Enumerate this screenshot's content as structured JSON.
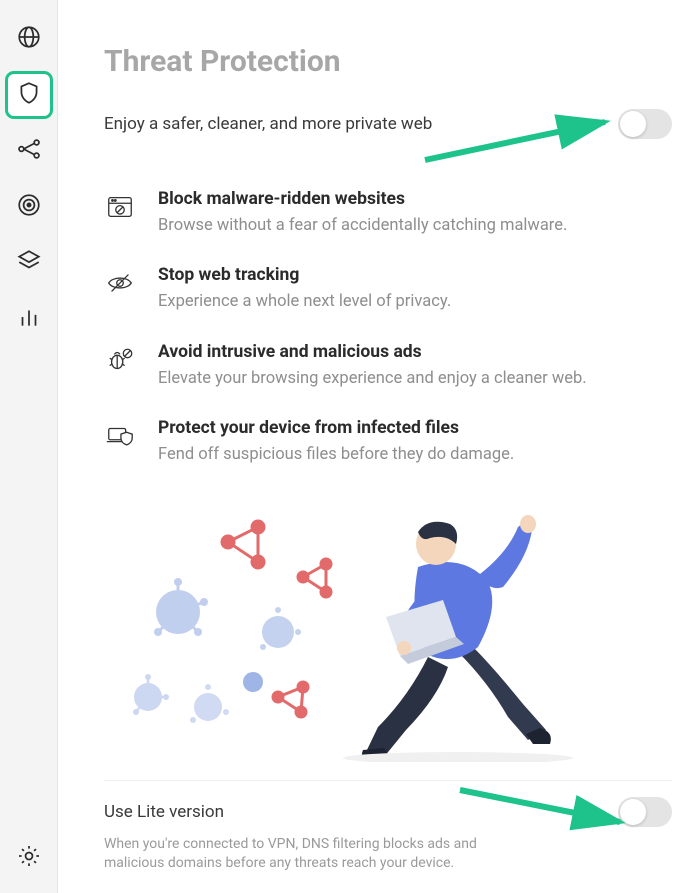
{
  "page": {
    "title": "Threat Protection",
    "subtitle": "Enjoy a safer, cleaner, and more private web"
  },
  "features": [
    {
      "title": "Block malware-ridden websites",
      "desc": "Browse without a fear of accidentally catching malware."
    },
    {
      "title": "Stop web tracking",
      "desc": "Experience a whole next level of privacy."
    },
    {
      "title": "Avoid intrusive and malicious ads",
      "desc": "Elevate your browsing experience and enjoy a cleaner web."
    },
    {
      "title": "Protect your device from infected files",
      "desc": "Fend off suspicious files before they do damage."
    }
  ],
  "lite": {
    "title": "Use Lite version",
    "desc": "When you're connected to VPN, DNS filtering blocks ads and malicious domains before any threats reach your device."
  },
  "toggles": {
    "main_enabled": false,
    "lite_enabled": false
  },
  "accent_color": "#1ec28b"
}
